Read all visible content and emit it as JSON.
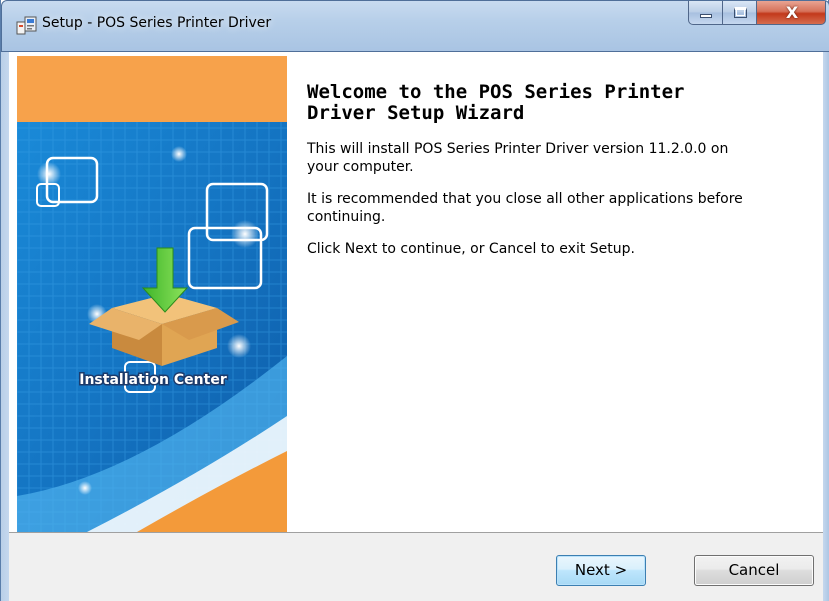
{
  "window": {
    "title": "Setup - POS Series Printer Driver",
    "close_glyph": "X"
  },
  "side_panel": {
    "caption": "Installation Center",
    "image": "installation-center-box-illustration"
  },
  "content": {
    "heading_line1": "Welcome to the POS Series Printer",
    "heading_line2": "Driver Setup Wizard",
    "paragraph1_line1": "This will install POS Series Printer Driver version 11.2.0.0 on",
    "paragraph1_line2": "your computer.",
    "paragraph2_line1": "It is recommended that you close all other applications before",
    "paragraph2_line2": "continuing.",
    "paragraph3": "Click Next to continue, or Cancel to exit Setup."
  },
  "buttons": {
    "next_label": "Next >",
    "cancel_label": "Cancel"
  },
  "colors": {
    "title_bar": "#b7cfe9",
    "panel_orange": "#f7a24b",
    "panel_blue": "#1479c9",
    "next_button": "#bee6fd"
  }
}
